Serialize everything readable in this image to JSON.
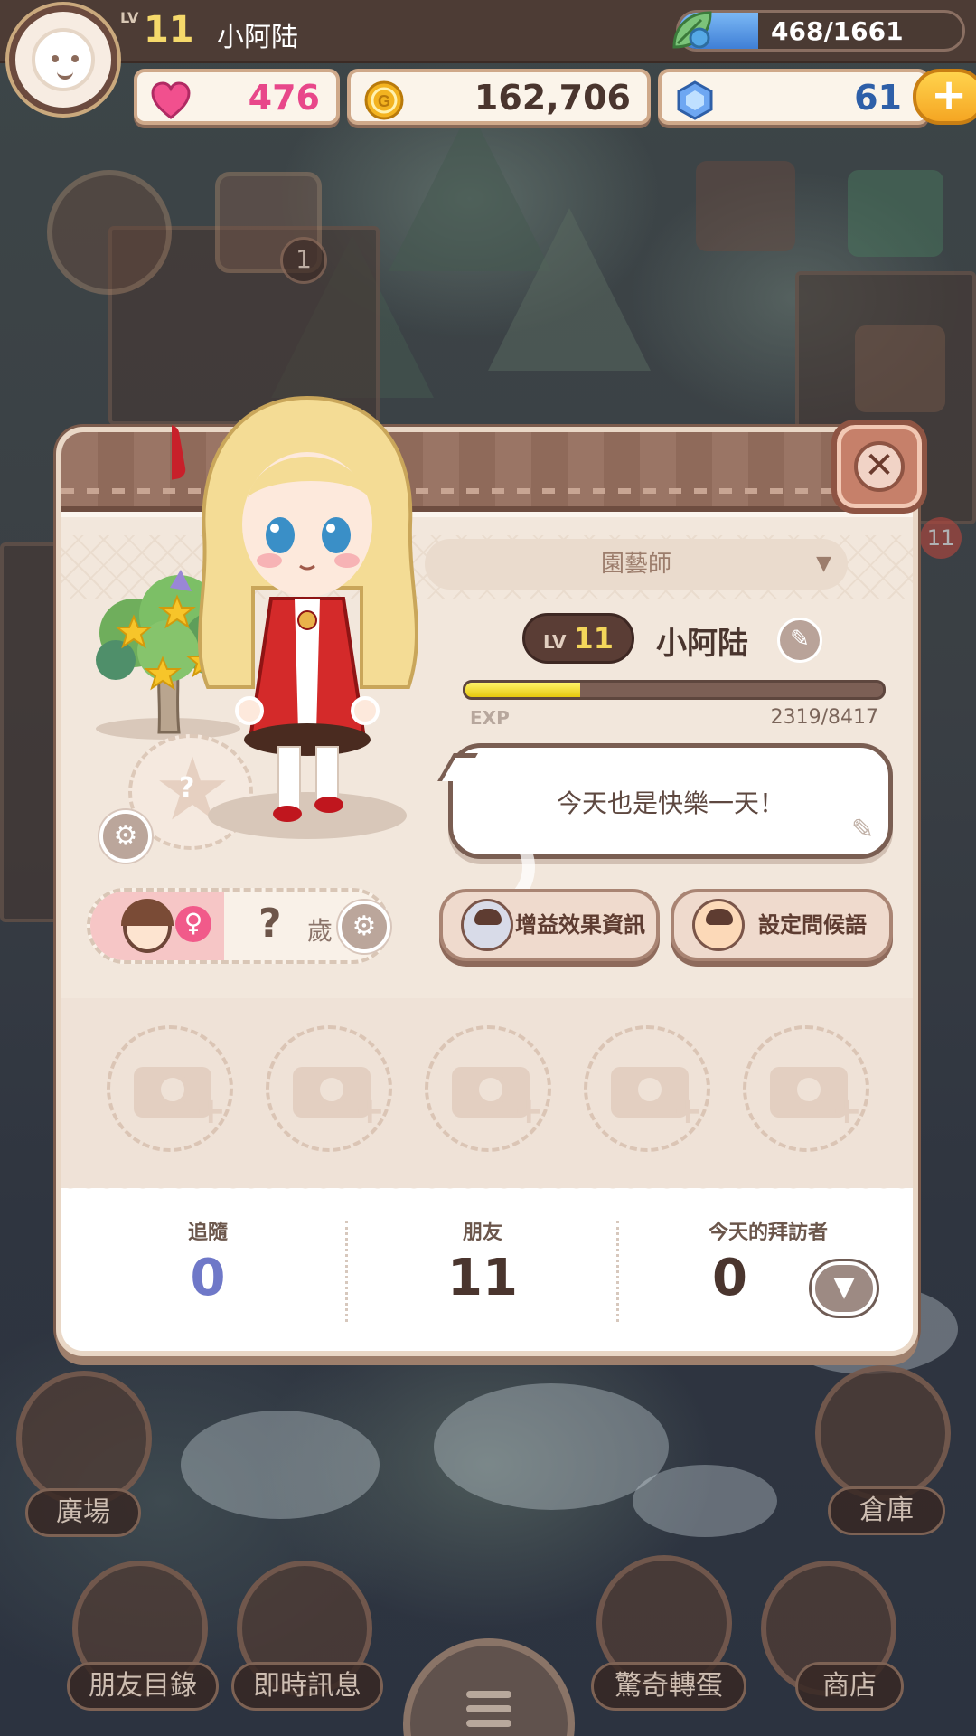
{
  "hud": {
    "level_tag": "LV",
    "level": "11",
    "player_name": "小阿陆",
    "exp_text": "468/1661",
    "exp_fraction": 0.28,
    "hearts": "476",
    "coins": "162,706",
    "gems": "61",
    "plus_label": "+",
    "calendar_badge": "1",
    "notification_badge": "11"
  },
  "profile": {
    "job_title": "園藝師",
    "level_tag": "LV",
    "level": "11",
    "name": "小阿陆",
    "exp_label": "EXP",
    "exp_value": "2319/8417",
    "exp_fraction": 0.275,
    "greeting": "今天也是快樂一天！",
    "age_value": "?",
    "age_unit": "歲",
    "buff_button_label": "增益效果資訊",
    "greet_button_label": "設定問候語",
    "badge_placeholder": "?"
  },
  "stats": {
    "follow_label": "追隨",
    "follow_value": "0",
    "friends_label": "朋友",
    "friends_value": "11",
    "visitors_label": "今天的拜訪者",
    "visitors_value": "0"
  },
  "dock": {
    "plaza": "廣場",
    "warehouse": "倉庫",
    "friend_list": "朋友目錄",
    "instant_message": "即時訊息",
    "gacha": "驚奇轉蛋",
    "shop": "商店"
  },
  "colors": {
    "heart_value": "#e8478a",
    "coin_value": "#4a352e",
    "gem_value": "#2e5fa8",
    "follow_value": "#6f78c8",
    "friends_value": "#4a352e",
    "visitors_value": "#4a352e",
    "accent_gold": "#f5a623"
  }
}
